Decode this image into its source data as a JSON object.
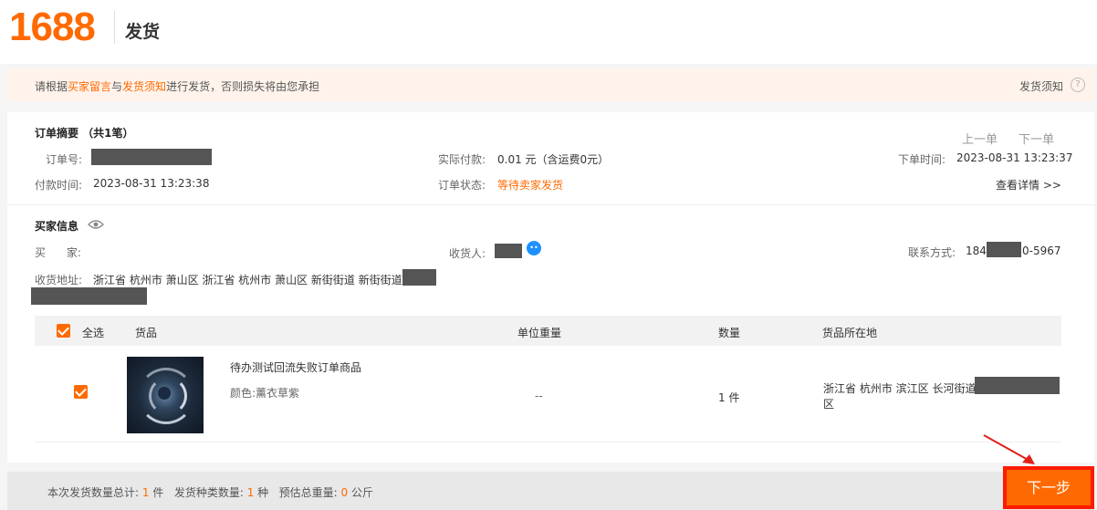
{
  "header": {
    "logo": "1688",
    "title": "发货"
  },
  "notice": {
    "prefix": "请根据",
    "link1": "买家留言",
    "mid": "与",
    "link2": "发货须知",
    "suffix": "进行发货，否则损失将由您承担",
    "right_link": "发货须知"
  },
  "order": {
    "title": "订单摘要 （共1笔）",
    "prev": "上一单",
    "next": "下一单",
    "order_no_label": "订单号:",
    "paid_label": "实际付款:",
    "paid_value": "0.01 元（含运费0元）",
    "order_time_label": "下单时间:",
    "order_time_value": "2023-08-31 13:23:37",
    "pay_time_label": "付款时间:",
    "pay_time_value": "2023-08-31 13:23:38",
    "status_label": "订单状态:",
    "status_value": "等待卖家发货",
    "detail_link": "查看详情 >>"
  },
  "buyer": {
    "title": "买家信息",
    "buyer_label": "买      家:",
    "receiver_label": "收货人:",
    "contact_label": "联系方式:",
    "contact_prefix": "184",
    "contact_suffix": "0-5967",
    "address_label": "收货地址:",
    "address_value": "浙江省 杭州市 萧山区 浙江省 杭州市 萧山区 新街街道 新街街道"
  },
  "table": {
    "select_all": "全选",
    "col_goods": "货品",
    "col_weight": "单位重量",
    "col_qty": "数量",
    "col_location": "货品所在地",
    "rows": [
      {
        "name": "待办测试回流失败订单商品",
        "spec": "颜色:薰衣草紫",
        "weight": "--",
        "qty": "1 件",
        "location_line1": "浙江省 杭州市 滨江区 长河街道",
        "location_line2": "区"
      }
    ]
  },
  "footer": {
    "total_qty_label": "本次发货数量总计:",
    "total_qty_value": "1",
    "total_qty_unit": "件",
    "kinds_label": "发货种类数量:",
    "kinds_value": "1",
    "kinds_unit": "种",
    "weight_label": "预估总重量:",
    "weight_value": "0",
    "weight_unit": "公斤",
    "next_button": "下一步"
  },
  "colors": {
    "accent": "#ff6a00",
    "highlight_box": "#ff1a00",
    "annotation_arrow": "#e0201a"
  }
}
